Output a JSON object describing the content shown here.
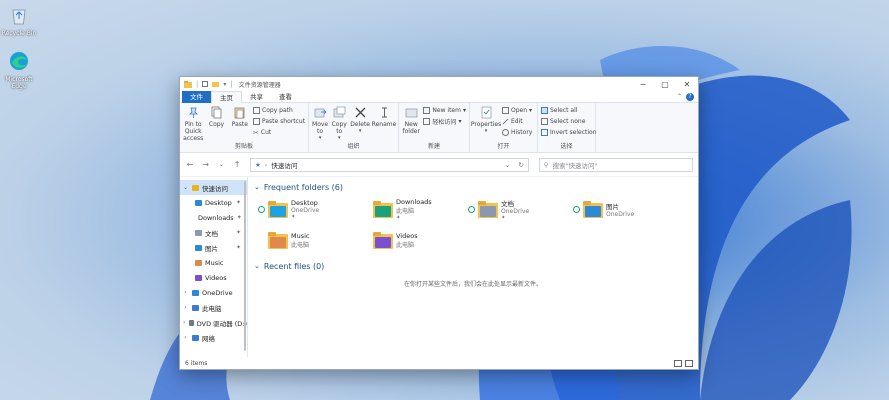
{
  "desktop": {
    "icons": [
      {
        "label": "Recycle Bin",
        "icon": "recycle-bin-icon"
      },
      {
        "label": "Microsoft Edge",
        "icon": "edge-icon"
      }
    ]
  },
  "window": {
    "title": "文件资源管理器",
    "controls": {
      "minimize": "−",
      "maximize": "▢",
      "close": "✕"
    },
    "tabs": [
      "文件",
      "主页",
      "共享",
      "查看"
    ],
    "active_tab": "主页"
  },
  "ribbon": {
    "clipboard": {
      "name": "剪贴板",
      "pin": "Pin to Quick access",
      "copy": "Copy",
      "paste": "Paste",
      "copy_path": "Copy path",
      "paste_shortcut": "Paste shortcut",
      "cut": "Cut"
    },
    "organize": {
      "name": "组织",
      "move_to": "Move to",
      "copy_to": "Copy to",
      "delete": "Delete",
      "rename": "Rename"
    },
    "new": {
      "name": "新建",
      "new_folder": "New folder",
      "new_item": "New item",
      "easy_access": "轻松访问"
    },
    "open": {
      "name": "打开",
      "properties": "Properties",
      "open": "Open",
      "edit": "Edit",
      "history": "History"
    },
    "select": {
      "name": "选择",
      "select_all": "Select all",
      "select_none": "Select none",
      "invert": "Invert selection"
    }
  },
  "address": {
    "path": "快速访问",
    "search_placeholder": "搜索\"快速访问\""
  },
  "nav": {
    "items": [
      {
        "label": "快速访问",
        "level": 0,
        "selected": true,
        "expand": "⌄"
      },
      {
        "label": "Desktop",
        "level": 1,
        "pinned": true
      },
      {
        "label": "Downloads",
        "level": 1,
        "pinned": true
      },
      {
        "label": "文档",
        "level": 1,
        "pinned": true
      },
      {
        "label": "图片",
        "level": 1,
        "pinned": true
      },
      {
        "label": "Music",
        "level": 1
      },
      {
        "label": "Videos",
        "level": 1
      },
      {
        "label": "OneDrive",
        "level": 0,
        "expand": "›"
      },
      {
        "label": "此电脑",
        "level": 0,
        "expand": "›"
      },
      {
        "label": "DVD 驱动器 (D:)",
        "level": 0,
        "expand": "›"
      },
      {
        "label": "网络",
        "level": 0,
        "expand": "›"
      }
    ],
    "pin_glyph": "✦"
  },
  "frequent": {
    "header": "Frequent folders (6)",
    "folders": [
      {
        "name": "Desktop",
        "location": "OneDrive",
        "pinned": true,
        "color": "#1fa2e0"
      },
      {
        "name": "Downloads",
        "location": "此电脑",
        "pinned": true,
        "color": "#1aa37a"
      },
      {
        "name": "文档",
        "location": "OneDrive",
        "pinned": true,
        "color": "#8a9aae"
      },
      {
        "name": "图片",
        "location": "OneDrive",
        "pinned": false,
        "color": "#2b8ad8"
      },
      {
        "name": "Music",
        "location": "此电脑",
        "pinned": false,
        "color": "#e0894a"
      },
      {
        "name": "Videos",
        "location": "此电脑",
        "pinned": false,
        "color": "#7a4fd0"
      }
    ]
  },
  "recent": {
    "header": "Recent files (0)",
    "empty_text": "在你打开某些文件后，我们会在此处显示最新文件。"
  },
  "status": {
    "count": "6 items"
  },
  "colors": {
    "accent": "#1f6fc5",
    "section_header": "#1e4f86",
    "selected_nav": "#cfe4f8"
  }
}
